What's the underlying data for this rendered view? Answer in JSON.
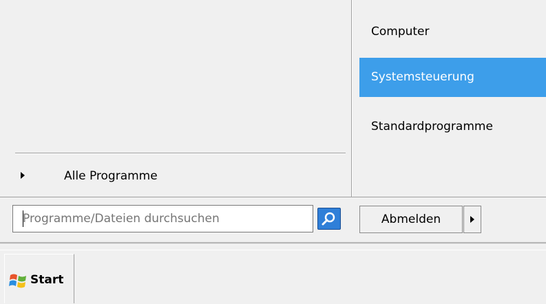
{
  "start_menu": {
    "all_programs_label": "Alle Programme",
    "right_items": [
      {
        "label": "Computer",
        "selected": false
      },
      {
        "label": "Systemsteuerung",
        "selected": true
      },
      {
        "label": "Standardprogramme",
        "selected": false
      }
    ],
    "search": {
      "placeholder": "Programme/Dateien durchsuchen",
      "value": ""
    },
    "logout_label": "Abmelden"
  },
  "taskbar": {
    "start_label": "Start"
  },
  "colors": {
    "selection": "#3d9eea",
    "background": "#f0f0f0"
  }
}
